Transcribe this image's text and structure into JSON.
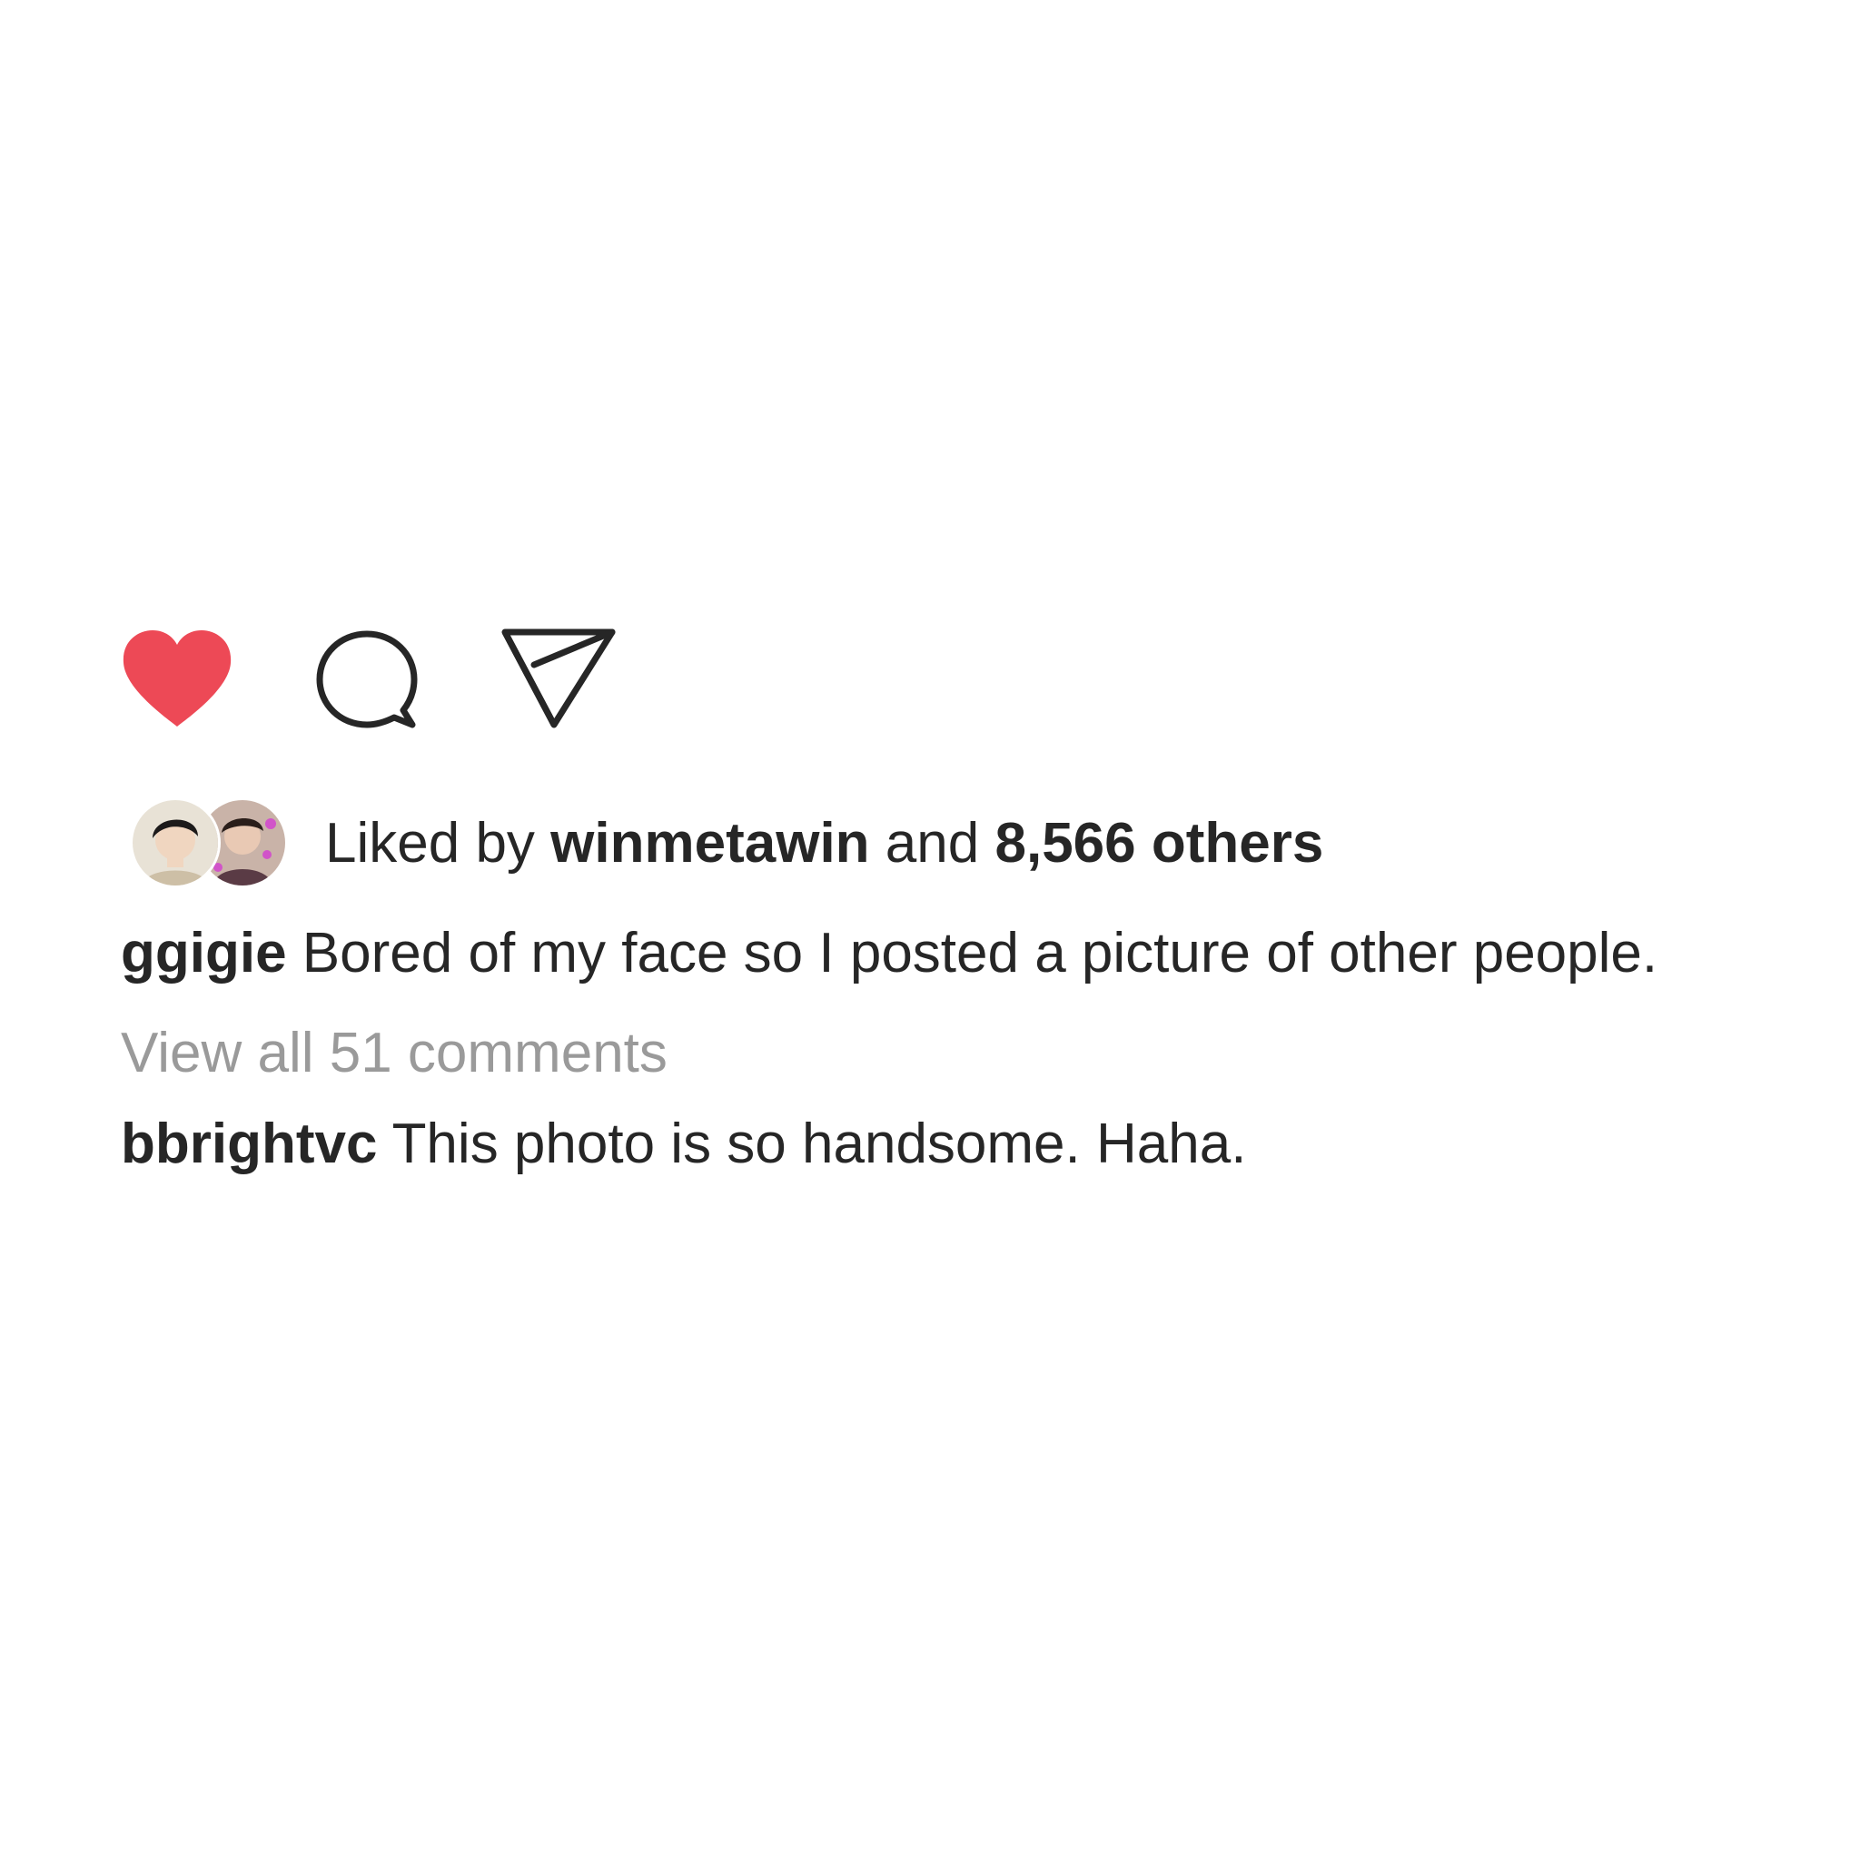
{
  "actions": {
    "like_icon": "heart-filled-icon",
    "comment_icon": "speech-bubble-icon",
    "share_icon": "paper-plane-icon",
    "like_color": "#ed4956"
  },
  "likes": {
    "prefix": "Liked by",
    "liker_username": "winmetawin",
    "connector": "and",
    "others_count": "8,566 others"
  },
  "caption": {
    "username": "ggigie",
    "text": "Bored of my face so I posted a picture of other people."
  },
  "comments": {
    "view_all_label": "View all 51 comments",
    "items": [
      {
        "username": "bbrightvc",
        "text": "This photo is so handsome. Haha."
      }
    ]
  }
}
